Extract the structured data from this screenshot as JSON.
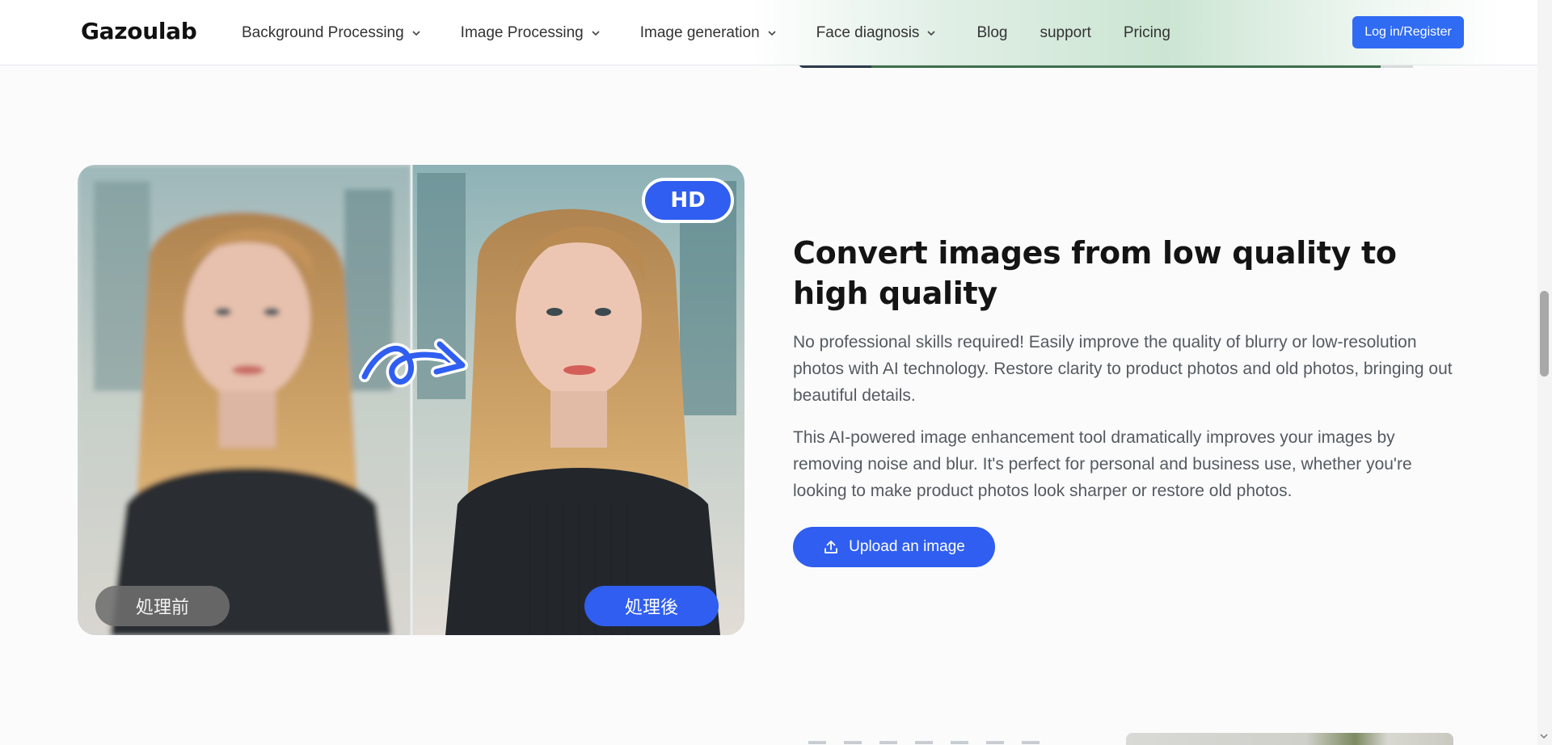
{
  "header": {
    "logo": "Gazoulab",
    "nav": [
      {
        "label": "Background Processing",
        "has_dropdown": true
      },
      {
        "label": "Image Processing",
        "has_dropdown": true
      },
      {
        "label": "Image generation",
        "has_dropdown": true
      },
      {
        "label": "Face diagnosis",
        "has_dropdown": true
      },
      {
        "label": "Blog",
        "has_dropdown": false
      },
      {
        "label": "support",
        "has_dropdown": false
      },
      {
        "label": "Pricing",
        "has_dropdown": false
      }
    ],
    "login_label": "Log in/Register"
  },
  "hero": {
    "badge": "HD",
    "before_label": "処理前",
    "after_label": "処理後",
    "title": "Convert images from low quality to high quality",
    "paragraph1": "No professional skills required! Easily improve the quality of blurry or low-resolution photos with AI technology. Restore clarity to product photos and old photos, bringing out beautiful details.",
    "paragraph2": "This AI-powered image enhancement tool dramatically improves your images by removing noise and blur. It's perfect for personal and business use, whether you're looking to make product photos look sharper or restore old photos.",
    "upload_label": "Upload an image",
    "upload_icon": "upload-icon"
  },
  "colors": {
    "accent": "#2f5ef0",
    "login": "#2f6bf3",
    "background": "#fbfbfc"
  }
}
